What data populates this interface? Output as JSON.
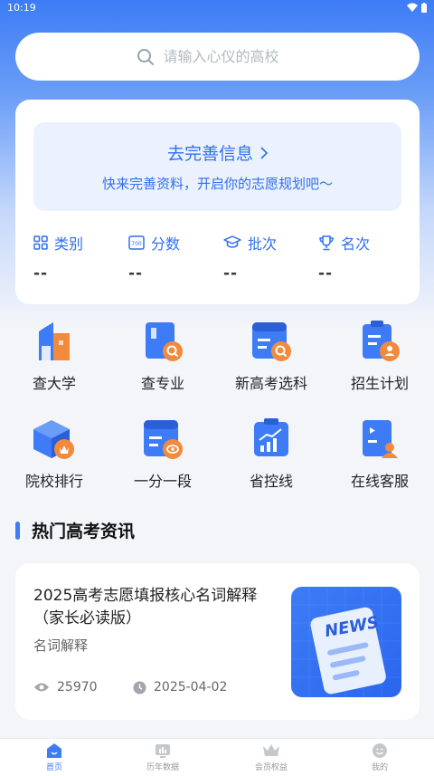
{
  "status_bar": {
    "time": "10:19"
  },
  "search": {
    "placeholder": "请输入心仪的高校"
  },
  "profile": {
    "title": "去完善信息",
    "subtitle": "快来完善资料，开启你的志愿规划吧～",
    "stats": [
      {
        "label": "类别",
        "value": "--",
        "icon": "grid-icon"
      },
      {
        "label": "分数",
        "value": "--",
        "icon": "score-icon"
      },
      {
        "label": "批次",
        "value": "--",
        "icon": "graduation-cap-icon"
      },
      {
        "label": "名次",
        "value": "--",
        "icon": "trophy-icon"
      }
    ]
  },
  "features": [
    {
      "label": "查大学",
      "icon": "university-icon"
    },
    {
      "label": "查专业",
      "icon": "major-search-icon"
    },
    {
      "label": "新高考选科",
      "icon": "subject-select-icon"
    },
    {
      "label": "招生计划",
      "icon": "enrollment-plan-icon"
    },
    {
      "label": "院校排行",
      "icon": "ranking-icon"
    },
    {
      "label": "一分一段",
      "icon": "score-segment-icon"
    },
    {
      "label": "省控线",
      "icon": "control-line-icon"
    },
    {
      "label": "在线客服",
      "icon": "customer-service-icon"
    }
  ],
  "news_section": {
    "title": "热门高考资讯",
    "items": [
      {
        "title": "2025高考志愿填报核心名词解释（家长必读版）",
        "category": "名词解释",
        "views": "25970",
        "date": "2025-04-02",
        "thumb_text": "NEWS"
      }
    ]
  },
  "tabs": [
    {
      "label": "首页",
      "icon": "home-icon",
      "active": true
    },
    {
      "label": "历年数据",
      "icon": "data-icon",
      "active": false
    },
    {
      "label": "会员权益",
      "icon": "crown-icon",
      "active": false
    },
    {
      "label": "我的",
      "icon": "profile-icon",
      "active": false
    }
  ],
  "colors": {
    "primary": "#3d7cf6",
    "accent_orange": "#f28a3c"
  }
}
